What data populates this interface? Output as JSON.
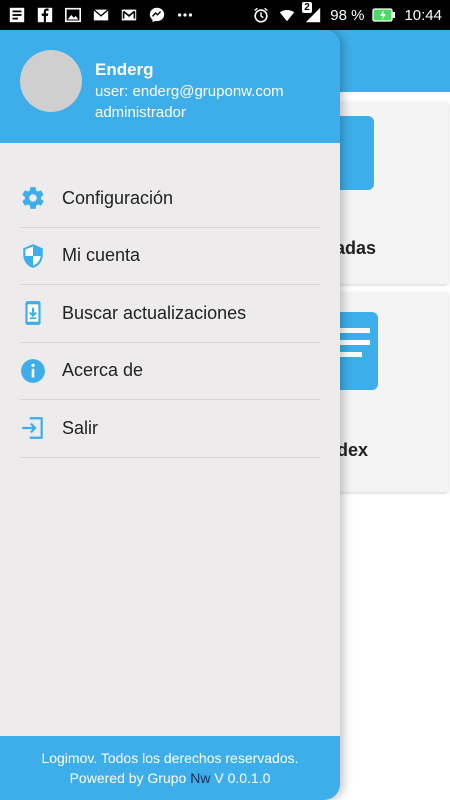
{
  "status_bar": {
    "battery": "98 %",
    "time": "10:44",
    "notification_count": "2",
    "icons": [
      "news-icon",
      "facebook-icon",
      "image-icon",
      "mail-icon",
      "gmail-icon",
      "messenger-icon",
      "more-dots-icon",
      "alarm-icon",
      "wifi-icon",
      "signal-icon",
      "battery-icon"
    ]
  },
  "background_app": {
    "card1_label": "adas",
    "card2_label": "dex"
  },
  "drawer": {
    "user": {
      "name": "Enderg",
      "email": "user: enderg@gruponw.com",
      "role": "administrador"
    },
    "menu": [
      {
        "label": "Configuración",
        "icon": "gear-icon"
      },
      {
        "label": "Mi cuenta",
        "icon": "shield-icon"
      },
      {
        "label": "Buscar actualizaciones",
        "icon": "phone-download-icon"
      },
      {
        "label": "Acerca de",
        "icon": "info-icon"
      },
      {
        "label": "Salir",
        "icon": "exit-icon"
      }
    ],
    "footer": {
      "line1": "Logimov. Todos los derechos reservados.",
      "line2_prefix": "Powered by Grupo ",
      "line2_brand": "Nw",
      "line2_suffix": " V 0.0.1.0"
    }
  },
  "colors": {
    "accent": "#3daee9",
    "drawer_bg": "#edebeb",
    "brand_nw": "#1a2d5a"
  }
}
